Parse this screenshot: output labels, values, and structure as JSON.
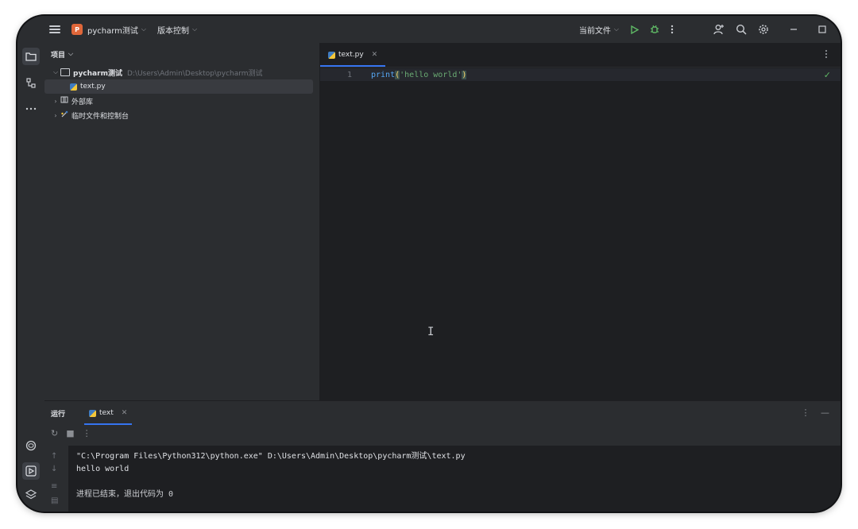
{
  "titlebar": {
    "project_badge": "P",
    "project_name": "pycharm测试",
    "vcs_label": "版本控制",
    "current_file_label": "当前文件",
    "chevron": "⌵"
  },
  "project_panel": {
    "header": "项目",
    "tree": [
      {
        "label": "pycharm测试",
        "path": "D:\\Users\\Admin\\Desktop\\pycharm测试"
      },
      {
        "label": "text.py"
      },
      {
        "label": "外部库"
      },
      {
        "label": "临时文件和控制台"
      }
    ]
  },
  "editor": {
    "tab_label": "text.py",
    "line_number": "1",
    "code": {
      "fn": "print",
      "open": "(",
      "str": "'hello world'",
      "close": ")"
    }
  },
  "run_panel": {
    "title": "运行",
    "tab_label": "text",
    "console": [
      "\"C:\\Program Files\\Python312\\python.exe\" D:\\Users\\Admin\\Desktop\\pycharm测试\\text.py",
      "hello world",
      "",
      "进程已结束，退出代码为 0"
    ]
  },
  "colors": {
    "accent": "#3574f0",
    "run_green": "#5fb865",
    "project_badge": "#e0673a"
  }
}
